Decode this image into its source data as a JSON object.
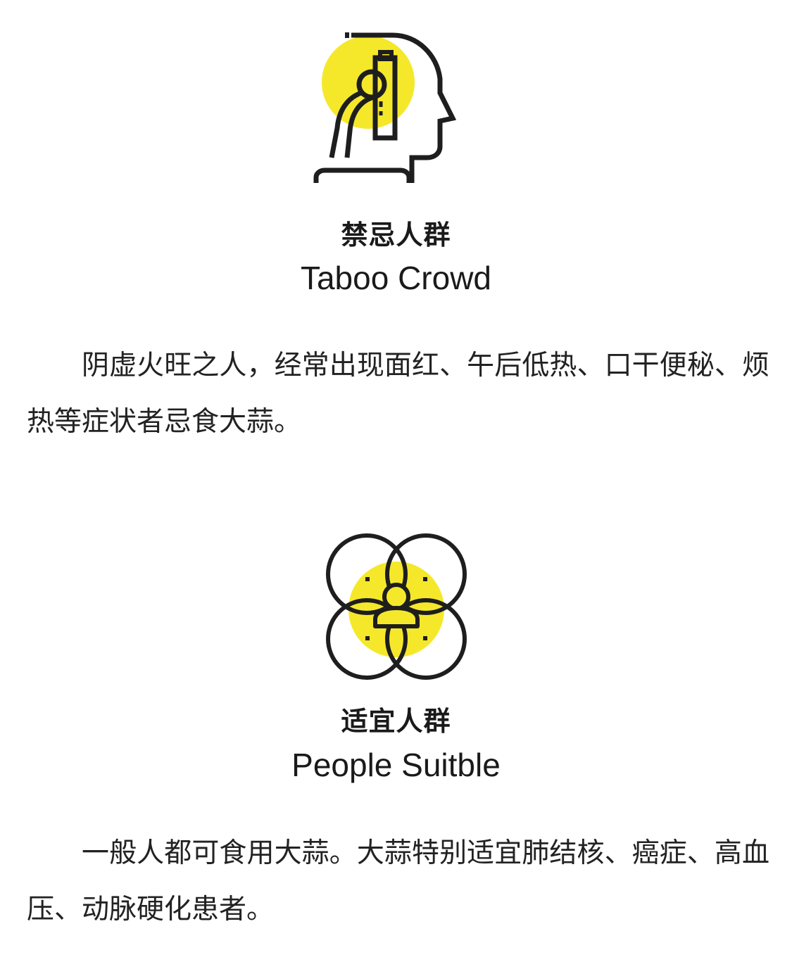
{
  "sections": [
    {
      "icon": "head-microscope-icon",
      "title_cn": "禁忌人群",
      "title_en": "Taboo Crowd",
      "body": "阴虚火旺之人，经常出现面红、午后低热、口干便秘、烦热等症状者忌食大蒜。"
    },
    {
      "icon": "overlapping-circles-person-icon",
      "title_cn": "适宜人群",
      "title_en": "People Suitble",
      "body": "一般人都可食用大蒜。大蒜特别适宜肺结核、癌症、高血压、动脉硬化患者。"
    }
  ],
  "colors": {
    "accent_yellow": "#f5e82a",
    "line_dark": "#1e1e1e",
    "text": "#222222",
    "background": "#ffffff"
  }
}
